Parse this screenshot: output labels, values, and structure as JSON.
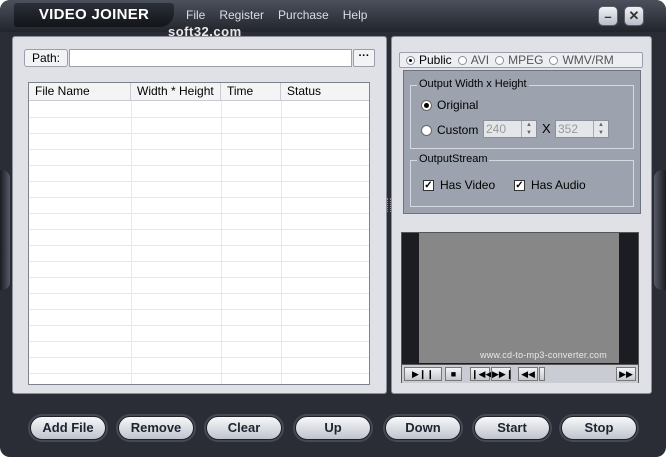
{
  "app": {
    "title": "VIDEO JOINER",
    "watermark": "soft32.com"
  },
  "menu": {
    "items": [
      "File",
      "Register",
      "Purchase",
      "Help"
    ]
  },
  "window_controls": {
    "minimize": "–",
    "close": "✕"
  },
  "path": {
    "label": "Path:",
    "value": "",
    "browse_label": "···"
  },
  "file_table": {
    "columns": [
      "File Name",
      "Width * Height",
      "Time",
      "Status"
    ],
    "rows": []
  },
  "format_tabs": {
    "items": [
      "Public",
      "AVI",
      "MPEG",
      "WMV/RM"
    ],
    "selected": "Public"
  },
  "output_size": {
    "title": "Output Width x Height",
    "original_label": "Original",
    "custom_label": "Custom",
    "selected": "original",
    "width": "240",
    "height": "352",
    "times": "X"
  },
  "output_stream": {
    "title": "OutputStream",
    "video_label": "Has Video",
    "video_checked": true,
    "audio_label": "Has Audio",
    "audio_checked": true
  },
  "preview": {
    "url_text": "www.cd-to-mp3-converter.com"
  },
  "player": {
    "play_pause": "▶❙❙",
    "stop": "■",
    "prev": "❙◀◀",
    "next": "▶▶❙",
    "rewind": "◀◀",
    "forward": "▶▶"
  },
  "buttons": {
    "add_file": "Add File",
    "remove": "Remove",
    "clear": "Clear",
    "up": "Up",
    "down": "Down",
    "start": "Start",
    "stop": "Stop"
  }
}
